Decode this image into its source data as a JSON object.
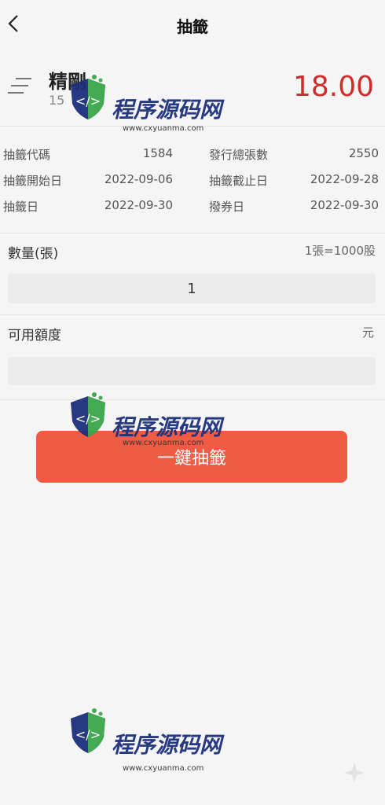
{
  "header": {
    "title": "抽籤"
  },
  "stock": {
    "name": "精剛",
    "code": "15",
    "price": "18.00"
  },
  "info": {
    "rows": [
      {
        "l1": "抽籤代碼",
        "v1": "1584",
        "l2": "發行總張數",
        "v2": "2550"
      },
      {
        "l1": "抽籤開始日",
        "v1": "2022-09-06",
        "l2": "抽籤截止日",
        "v2": "2022-09-28"
      },
      {
        "l1": "抽籤日",
        "v1": "2022-09-30",
        "l2": "撥券日",
        "v2": "2022-09-30"
      }
    ]
  },
  "quantity": {
    "label": "數量(張)",
    "note": "1張=1000股",
    "value": "1"
  },
  "available": {
    "label": "可用額度",
    "unit": "元",
    "value": ""
  },
  "submit": {
    "label": "一鍵抽籤"
  },
  "watermark": {
    "text": "程序源码网",
    "url": "www.cxyuanma.com"
  },
  "colors": {
    "price": "#d22b2b",
    "button": "#f05b44",
    "watermark_blue": "#1d2f7a",
    "watermark_green": "#3aa64a"
  },
  "icons": {
    "back": "chevron-left-icon",
    "menu": "menu-lines-icon",
    "star": "sparkle-icon"
  }
}
